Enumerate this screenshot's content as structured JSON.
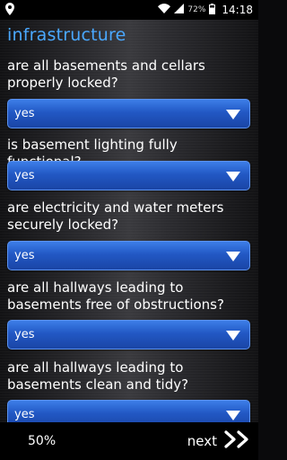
{
  "status_bar": {
    "battery": "72%",
    "time": "14:18"
  },
  "section": {
    "title": "infrastructure"
  },
  "questions": [
    {
      "text": "are all basements and cellars properly locked?",
      "answer": "yes"
    },
    {
      "text": "is basement lighting fully functional?",
      "answer": "yes"
    },
    {
      "text": "are electricity and water meters securely locked?",
      "answer": "yes"
    },
    {
      "text": "are all hallways leading to basements free of obstructions?",
      "answer": "yes"
    },
    {
      "text": "are all hallways leading to basements clean and tidy?",
      "answer": "yes"
    }
  ],
  "footer": {
    "progress": "50%",
    "next_label": "next"
  }
}
